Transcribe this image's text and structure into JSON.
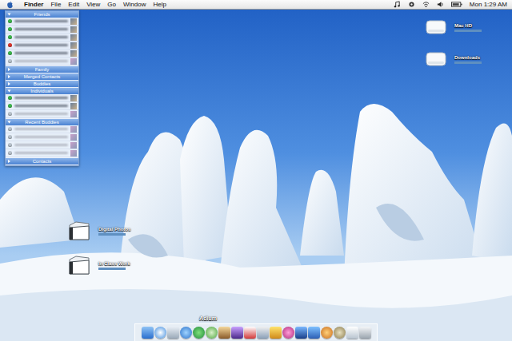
{
  "menu_bar": {
    "app": "Finder",
    "menus": [
      "File",
      "Edit",
      "View",
      "Go",
      "Window",
      "Help"
    ],
    "clock": "Mon 1:29 AM"
  },
  "buddy_list": {
    "groups": [
      {
        "name": "Friends",
        "expanded": true,
        "contacts": [
          {
            "color": "#3bb54a",
            "offline": false
          },
          {
            "color": "#3bb54a",
            "offline": false
          },
          {
            "color": "#3bb54a",
            "offline": false
          },
          {
            "color": "#d9342b",
            "offline": false
          },
          {
            "color": "#3bb54a",
            "offline": false
          },
          {
            "color": "#b8c2cc",
            "offline": true
          }
        ]
      },
      {
        "name": "Family",
        "expanded": false,
        "contacts": []
      },
      {
        "name": "Merged Contacts",
        "expanded": false,
        "contacts": []
      },
      {
        "name": "Buddies",
        "expanded": false,
        "contacts": []
      },
      {
        "name": "Individuals",
        "expanded": true,
        "contacts": [
          {
            "color": "#3bb54a",
            "offline": false
          },
          {
            "color": "#3bb54a",
            "offline": false
          },
          {
            "color": "#b8c2cc",
            "offline": true
          }
        ]
      },
      {
        "name": "Recent Buddies",
        "expanded": true,
        "contacts": [
          {
            "color": "#b8c2cc",
            "offline": true
          },
          {
            "color": "#b8c2cc",
            "offline": true
          },
          {
            "color": "#b8c2cc",
            "offline": true
          },
          {
            "color": "#b8c2cc",
            "offline": true
          }
        ]
      },
      {
        "name": "Contacts",
        "expanded": false,
        "contacts": []
      }
    ]
  },
  "desktop_icons": [
    {
      "label": "Mac HD",
      "kind": "drive"
    },
    {
      "label": "Downloads",
      "kind": "drive"
    },
    {
      "label": "Digital Photos",
      "kind": "folder"
    },
    {
      "label": "In Class Work",
      "kind": "folder"
    }
  ],
  "dock": {
    "hover_label": "Adium"
  }
}
